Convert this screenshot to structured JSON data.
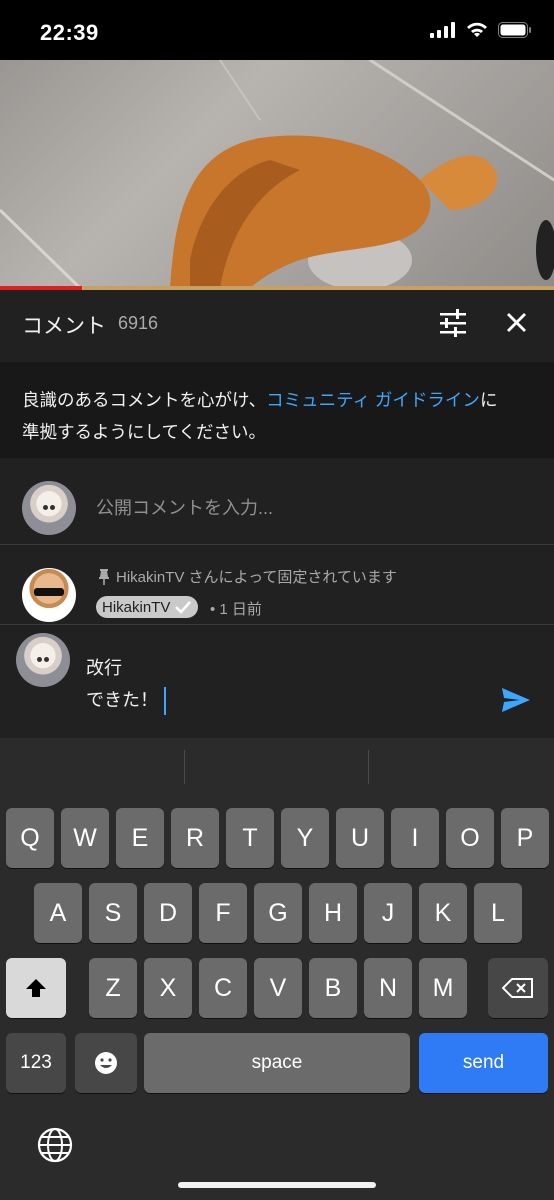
{
  "status": {
    "time": "22:39"
  },
  "comments": {
    "title": "コメント",
    "count": "6916",
    "notice_before": "良識のあるコメントを心がけ、",
    "notice_link": "コミュニティ ガイドライン",
    "notice_after_1": "に",
    "notice_after_2": "準拠するようにしてください。",
    "add_placeholder": "公開コメントを入力...",
    "pinned_text": "HikakinTV さんによって固定されています",
    "author": "HikakinTV",
    "age": "• 1 日前"
  },
  "composer": {
    "line1": "改行",
    "line2": "できた！"
  },
  "keyboard": {
    "row1": [
      "Q",
      "W",
      "E",
      "R",
      "T",
      "Y",
      "U",
      "I",
      "O",
      "P"
    ],
    "row2": [
      "A",
      "S",
      "D",
      "F",
      "G",
      "H",
      "J",
      "K",
      "L"
    ],
    "row3": [
      "Z",
      "X",
      "C",
      "V",
      "B",
      "N",
      "M"
    ],
    "numbers_label": "123",
    "space_label": "space",
    "send_label": "send"
  },
  "colors": {
    "accent": "#3ea6ff",
    "send_key": "#2f7af5"
  }
}
